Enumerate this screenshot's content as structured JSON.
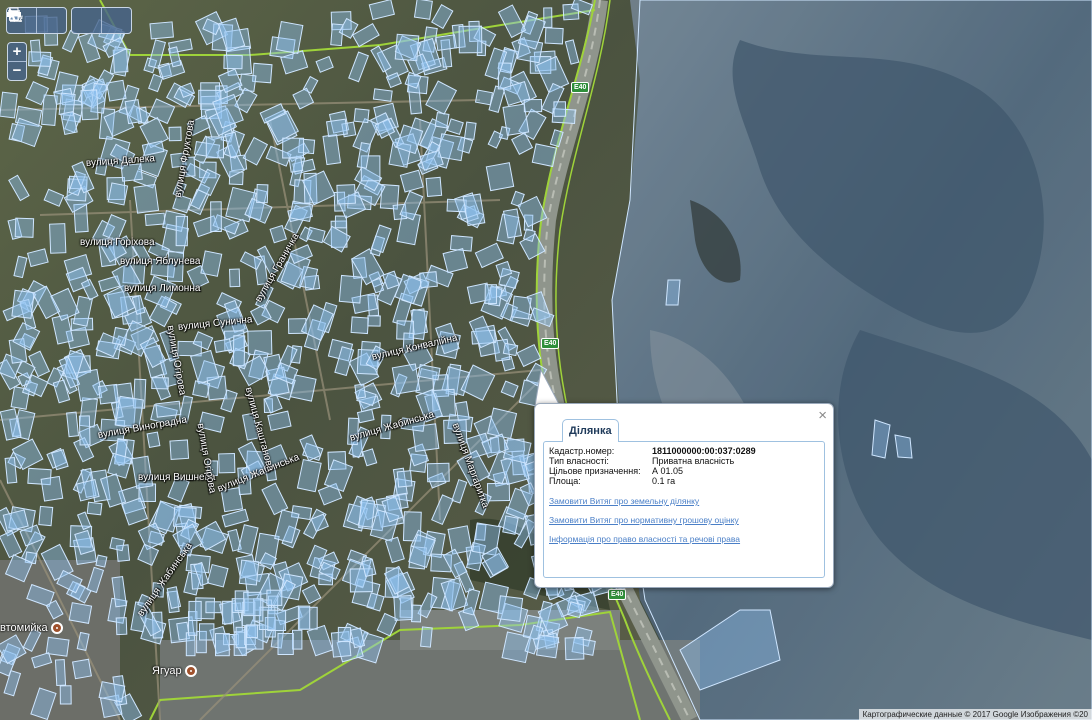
{
  "toolbar": {
    "buttons": [
      "measure-distance",
      "measure-area",
      "print",
      "identify"
    ],
    "zoom_in": "+",
    "zoom_out": "−"
  },
  "map": {
    "streets": [
      {
        "id": "s1",
        "text": "вулиця Далека"
      },
      {
        "id": "s2",
        "text": "вулиця Горіхова"
      },
      {
        "id": "s3",
        "text": "вулиця Яблунева"
      },
      {
        "id": "s4",
        "text": "вулиця Лимонна"
      },
      {
        "id": "s5",
        "text": "вулиця Сунична"
      },
      {
        "id": "s6",
        "text": "вулиця Конвалійна"
      },
      {
        "id": "s7",
        "text": "вулиця Жабинська"
      },
      {
        "id": "s8",
        "text": "вулиця Виноградна"
      },
      {
        "id": "s9",
        "text": "вулиця Вишнева"
      },
      {
        "id": "s10",
        "text": "вулиця Жабинська"
      },
      {
        "id": "s11",
        "text": "вулиця Жабинська"
      },
      {
        "id": "s12",
        "text": "вулиця Маргаритка"
      },
      {
        "id": "s13",
        "text": "вулиця Огірова"
      },
      {
        "id": "s14",
        "text": "вулиця Огірова"
      },
      {
        "id": "s15",
        "text": "вулиця Каштанова"
      },
      {
        "id": "s16",
        "text": "вулиця Граничка"
      },
      {
        "id": "s17",
        "text": "вулиця Фруктова"
      }
    ],
    "road_badges": [
      "E40",
      "E40",
      "E40"
    ],
    "pois": [
      {
        "id": "p1",
        "label": "втомийка"
      },
      {
        "id": "p2",
        "label": "Ягуар"
      }
    ],
    "copyright": "Картографические данные © 2017 Google Изображения ©20"
  },
  "popup": {
    "tab_label": "Ділянка",
    "close_label": "×",
    "attributes": [
      {
        "key": "Кадастр.номер:",
        "value": "1811000000:00:037:0289",
        "strong": true
      },
      {
        "key": "Тип власності:",
        "value": "Приватна власність",
        "strong": false
      },
      {
        "key": "Цільове призначення:",
        "value": "А 01.05",
        "strong": false
      },
      {
        "key": "Площа:",
        "value": "0.1 га",
        "strong": false
      }
    ],
    "links": [
      "Замовити Витяг про земельну ділянку",
      "Замовити Витяг про нормативну грошову оцінку",
      "Інформація про право власності та речові права"
    ]
  },
  "colors": {
    "parcel_fill": "#8fc0f0",
    "parcel_stroke": "#cfe6ff",
    "boundary": "#9fd33a",
    "accent": "#4a7fc7"
  }
}
